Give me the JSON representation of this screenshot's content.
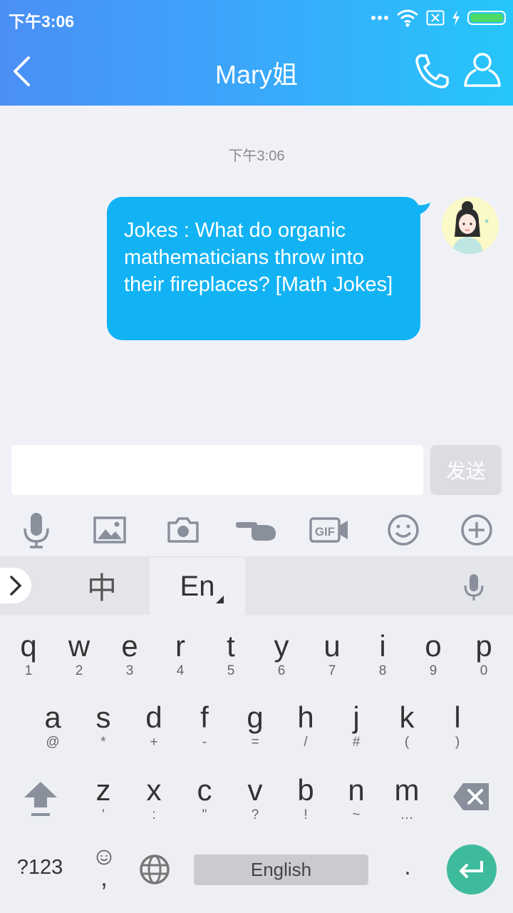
{
  "status": {
    "time": "下午3:06"
  },
  "header": {
    "title": "Mary姐"
  },
  "chat": {
    "timestamp": "下午3:06",
    "message": "Jokes : What do organic mathematicians throw into their fireplaces?  [Math Jokes]"
  },
  "input": {
    "value": "",
    "placeholder": "",
    "send_label": "发送"
  },
  "toolbar": [
    "microphone-icon",
    "image-icon",
    "camera-icon",
    "poke-hand-icon",
    "gif-icon",
    "emoji-icon",
    "plus-icon"
  ],
  "keyboard": {
    "lang_zh": "中",
    "lang_en": "En",
    "row1": [
      {
        "k": "q",
        "s": "1"
      },
      {
        "k": "w",
        "s": "2"
      },
      {
        "k": "e",
        "s": "3"
      },
      {
        "k": "r",
        "s": "4"
      },
      {
        "k": "t",
        "s": "5"
      },
      {
        "k": "y",
        "s": "6"
      },
      {
        "k": "u",
        "s": "7"
      },
      {
        "k": "i",
        "s": "8"
      },
      {
        "k": "o",
        "s": "9"
      },
      {
        "k": "p",
        "s": "0"
      }
    ],
    "row2": [
      {
        "k": "a",
        "s": "@"
      },
      {
        "k": "s",
        "s": "*"
      },
      {
        "k": "d",
        "s": "+"
      },
      {
        "k": "f",
        "s": "-"
      },
      {
        "k": "g",
        "s": "="
      },
      {
        "k": "h",
        "s": "/"
      },
      {
        "k": "j",
        "s": "#"
      },
      {
        "k": "k",
        "s": "("
      },
      {
        "k": "l",
        "s": ")"
      }
    ],
    "row3": [
      {
        "k": "z",
        "s": "'"
      },
      {
        "k": "x",
        "s": ":"
      },
      {
        "k": "c",
        "s": "\""
      },
      {
        "k": "v",
        "s": "?"
      },
      {
        "k": "b",
        "s": "!"
      },
      {
        "k": "n",
        "s": "~"
      },
      {
        "k": "m",
        "s": "…"
      }
    ],
    "symbols_label": "?123",
    "emoji_sub": ",",
    "space_label": "English",
    "period_label": "."
  },
  "colors": {
    "header_start": "#4b8ff5",
    "header_end": "#25c6fb",
    "bubble": "#12b3f4",
    "enter": "#3ebb9c"
  }
}
